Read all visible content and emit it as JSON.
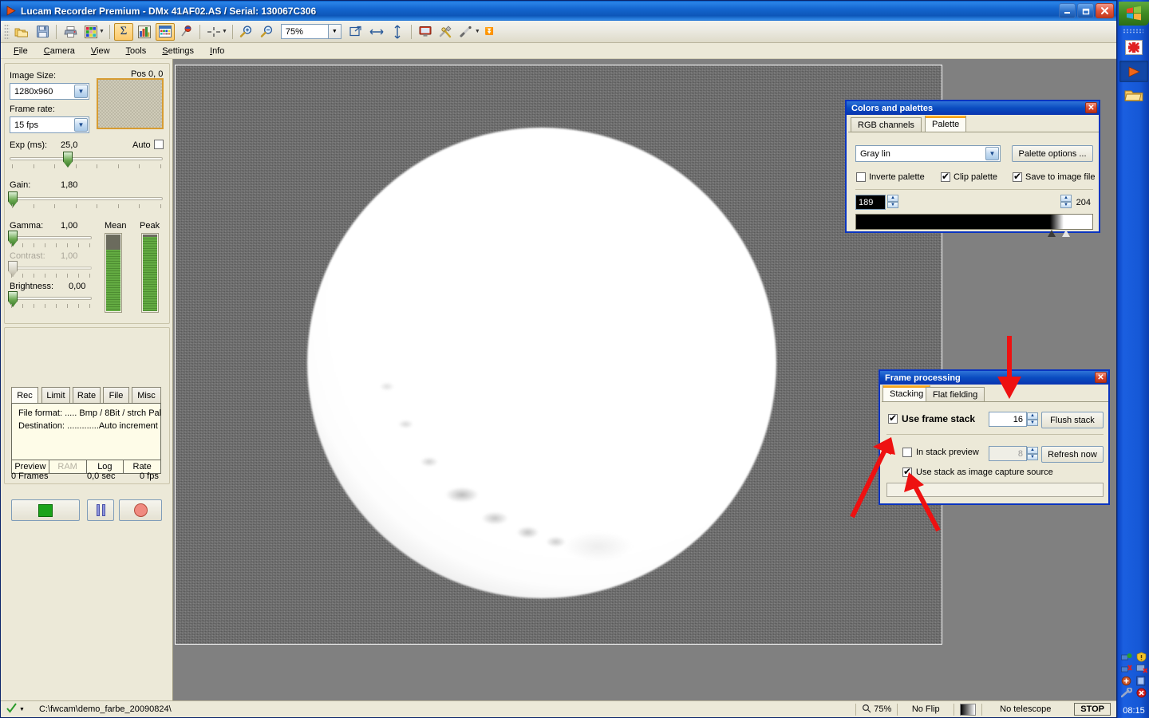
{
  "window": {
    "title": "Lucam Recorder Premium - DMx 41AF02.AS / Serial: 130067C306",
    "app_icon": "play-triangle-icon",
    "minimize": "_",
    "maximize": "❐",
    "close": "✕"
  },
  "toolbar": {
    "zoom_value": "75%",
    "buttons": [
      {
        "name": "open-folder-icon",
        "glyph": "folders"
      },
      {
        "name": "save-icon",
        "glyph": "floppy"
      },
      {
        "name": "print-icon",
        "glyph": "printer"
      },
      {
        "name": "color-grid-icon",
        "glyph": "grid"
      },
      {
        "name": "sum-sigma-icon",
        "glyph": "Σ",
        "active": true
      },
      {
        "name": "histogram-icon",
        "glyph": "histogram"
      },
      {
        "name": "palette-window-icon",
        "glyph": "window",
        "active": true
      },
      {
        "name": "color-picker-icon",
        "glyph": "picker"
      },
      {
        "name": "crosshair-icon",
        "glyph": "crosshair"
      },
      {
        "name": "zoom-in-icon",
        "glyph": "zoom+"
      },
      {
        "name": "zoom-out-icon",
        "glyph": "zoom-"
      },
      {
        "name": "fit-window-icon",
        "glyph": "fit"
      },
      {
        "name": "flip-horizontal-icon",
        "glyph": "⟺"
      },
      {
        "name": "flip-vertical-icon",
        "glyph": "⇕"
      },
      {
        "name": "monitor-icon",
        "glyph": "monitor"
      },
      {
        "name": "tools-icon",
        "glyph": "tools"
      },
      {
        "name": "wand-icon",
        "glyph": "wand"
      }
    ]
  },
  "menubar": {
    "items": [
      {
        "label": "File",
        "accel": "F"
      },
      {
        "label": "Camera",
        "accel": "C"
      },
      {
        "label": "View",
        "accel": "V"
      },
      {
        "label": "Tools",
        "accel": "T"
      },
      {
        "label": "Settings",
        "accel": "S"
      },
      {
        "label": "Info",
        "accel": "I"
      }
    ]
  },
  "camera_panel": {
    "image_size_label": "Image Size:",
    "image_size_value": "1280x960",
    "pos_label": "Pos  0, 0",
    "frame_rate_label": "Frame rate:",
    "frame_rate_value": "15 fps",
    "exposure_label": "Exp (ms):",
    "exposure_value": "25,0",
    "auto_label": "Auto",
    "auto_checked": false,
    "gain_label": "Gain:",
    "gain_value": "1,80",
    "gamma_label": "Gamma:",
    "gamma_value": "1,00",
    "contrast_label": "Contrast:",
    "contrast_value": "1,00",
    "contrast_disabled": true,
    "brightness_label": "Brightness:",
    "brightness_value": "0,00",
    "mean_label": "Mean",
    "peak_label": "Peak",
    "mean_percent": 78,
    "peak_percent": 95
  },
  "record_panel": {
    "tabs": [
      {
        "label": "Rec",
        "selected": true
      },
      {
        "label": "Limit",
        "selected": false
      },
      {
        "label": "Rate",
        "selected": false
      },
      {
        "label": "File",
        "selected": false
      },
      {
        "label": "Misc",
        "selected": false
      }
    ],
    "info": [
      "File format: ..... Bmp / 8Bit / strch Pal",
      "Destination: .............Auto increment"
    ],
    "subtabs": [
      {
        "label": "Preview",
        "disabled": false
      },
      {
        "label": "RAM",
        "disabled": true
      },
      {
        "label": "Log",
        "disabled": false
      },
      {
        "label": "Rate",
        "disabled": false
      }
    ],
    "buttons": [
      {
        "name": "live-button",
        "glyph": "green-square"
      },
      {
        "name": "pause-button",
        "glyph": "pause-bars"
      },
      {
        "name": "record-button",
        "glyph": "red-circle"
      }
    ],
    "status": {
      "frames": "0 Frames",
      "seconds": "0,0 sec",
      "fps": "0 fps"
    }
  },
  "colors_dialog": {
    "title": "Colors and palettes",
    "close": "✕",
    "tabs": [
      {
        "label": "RGB channels",
        "selected": false
      },
      {
        "label": "Palette",
        "selected": true
      }
    ],
    "palette_select": "Gray lin",
    "palette_options_button": "Palette options ...",
    "checkboxes": [
      {
        "label": "Inverte palette",
        "checked": false
      },
      {
        "label": "Clip palette",
        "checked": true
      },
      {
        "label": "Save to image file",
        "checked": true
      }
    ],
    "low_value": "189",
    "high_value": "204",
    "gradient_start_pct": 82,
    "gradient_end_pct": 88
  },
  "frame_processing_dialog": {
    "title": "Frame processing",
    "close": "✕",
    "tabs": [
      {
        "label": "Stacking",
        "selected": true
      },
      {
        "label": "Flat fielding",
        "selected": false
      }
    ],
    "use_frame_stack": {
      "label": "Use frame stack",
      "checked": true,
      "value": "16"
    },
    "flush_stack_button": "Flush stack",
    "in_stack_preview": {
      "label": "In stack preview",
      "checked": false,
      "value": "8",
      "disabled": true
    },
    "refresh_now_button": "Refresh now",
    "use_stack_as_source": {
      "label": "Use stack as image capture source",
      "checked": true
    }
  },
  "statusbar": {
    "check_icon": "green-check-icon",
    "path": "C:\\fwcam\\demo_farbe_20090824\\",
    "zoom": "75%",
    "flip": "No Flip",
    "telescope": "No telescope",
    "stop_button": "STOP"
  },
  "taskbar": {
    "start_icon": "windows-start-icon",
    "items": [
      {
        "name": "taskbar-item-redcross-app",
        "active": false
      },
      {
        "name": "taskbar-item-lucam-recorder",
        "active": true
      },
      {
        "name": "taskbar-item-explorer-folder",
        "active": false
      }
    ],
    "tray_icons": [
      "network-icon",
      "shield-warning-icon",
      "network-disconnected-icon",
      "monitor-error-icon",
      "update-icon",
      "display-icon",
      "settings-wrench-icon",
      "antivirus-error-icon"
    ],
    "clock": "08:15"
  },
  "annotations": {
    "arrow_color": "#ee1111",
    "arrows": [
      {
        "name": "arrow-to-frame-processing-tabs"
      },
      {
        "name": "arrow-to-in-stack-preview"
      },
      {
        "name": "arrow-to-use-stack-as-source"
      }
    ]
  }
}
